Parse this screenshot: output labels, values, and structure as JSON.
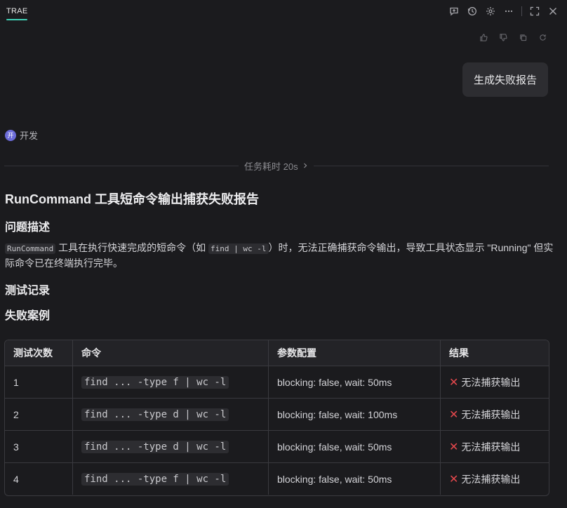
{
  "app": {
    "brand": "TRAE",
    "accent": "#3fd1b6"
  },
  "top_icons": [
    "new-chat-icon",
    "history-icon",
    "settings-icon",
    "more-icon",
    "expand-icon",
    "close-icon"
  ],
  "message_actions": [
    "thumbs-up-icon",
    "thumbs-down-icon",
    "copy-icon",
    "regenerate-icon"
  ],
  "user_message": "生成失败报告",
  "agent": {
    "avatar_text": "开",
    "name": "开发"
  },
  "task": {
    "label": "任务耗时 20s"
  },
  "report": {
    "title": "RunCommand 工具短命令输出捕获失败报告",
    "problem_heading": "问题描述",
    "problem": {
      "code1": "RunCommand",
      "text1": " 工具在执行快速完成的短命令（如 ",
      "code2": "find | wc -l",
      "text2": "）时，无法正确捕获命令输出，导致工具状态显示 \"Running\" 但实际命令已在终端执行完毕。"
    },
    "test_heading": "测试记录",
    "cases_heading": "失败案例",
    "table": {
      "headers": [
        "测试次数",
        "命令",
        "参数配置",
        "结果"
      ],
      "rows": [
        {
          "n": "1",
          "cmd": "find ... -type f | wc -l",
          "params": "blocking: false, wait: 50ms",
          "result": "无法捕获输出"
        },
        {
          "n": "2",
          "cmd": "find ... -type d | wc -l",
          "params": "blocking: false, wait: 100ms",
          "result": "无法捕获输出"
        },
        {
          "n": "3",
          "cmd": "find ... -type d | wc -l",
          "params": "blocking: false, wait: 50ms",
          "result": "无法捕获输出"
        },
        {
          "n": "4",
          "cmd": "find ... -type f | wc -l",
          "params": "blocking: false, wait: 50ms",
          "result": "无法捕获输出"
        }
      ]
    }
  }
}
